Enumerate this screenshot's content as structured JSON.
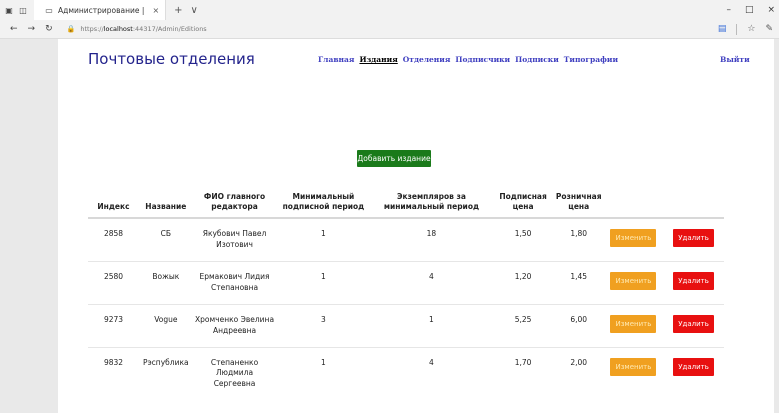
{
  "browser": {
    "tab_title": "Администрирование |",
    "tab_close": "×",
    "new_tab": "+",
    "tab_menu": "∨",
    "url_prefix": "https://",
    "url_host": "localhost",
    "url_path": ":44317/Admin/Editions",
    "win_minimize": "–",
    "win_maximize": "□",
    "win_close": "×"
  },
  "navbar": {
    "brand": "Почтовые отделения",
    "links": [
      "Главная",
      "Издания",
      "Отделения",
      "Подписчики",
      "Подписки",
      "Типографии"
    ],
    "active_index": 1,
    "logout": "Выйти"
  },
  "actions": {
    "add_label": "Добавить издание"
  },
  "table": {
    "headers": [
      "Индекс",
      "Название",
      "ФИО главного редактора",
      "Минимальный подписной период",
      "Экземпляров за минимальный период",
      "Подписная цена",
      "Розничная цена"
    ],
    "rows": [
      {
        "index": "2858",
        "name": "СБ",
        "editor": "Якубович Павел Изотович",
        "min_period": "1",
        "copies": "18",
        "sub_price": "1,50",
        "retail_price": "1,80"
      },
      {
        "index": "2580",
        "name": "Вожык",
        "editor": "Ермакович Лидия Степановна",
        "min_period": "1",
        "copies": "4",
        "sub_price": "1,20",
        "retail_price": "1,45"
      },
      {
        "index": "9273",
        "name": "Vogue",
        "editor": "Хромченко Эвелина Андреевна",
        "min_period": "3",
        "copies": "1",
        "sub_price": "5,25",
        "retail_price": "6,00"
      },
      {
        "index": "9832",
        "name": "Рэспублика",
        "editor": "Степаненко Людмила Сергеевна",
        "min_period": "1",
        "copies": "4",
        "sub_price": "1,70",
        "retail_price": "2,00"
      }
    ],
    "edit_label": "Изменить",
    "delete_label": "Удалить"
  },
  "colors": {
    "brand": "#23238c",
    "link": "#4040c0",
    "add": "#1a7a1a",
    "edit": "#f0a020",
    "delete": "#e81010"
  }
}
